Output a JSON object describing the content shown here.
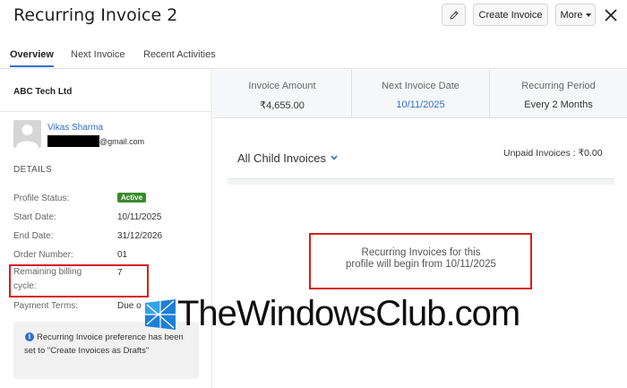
{
  "header": {
    "title": "Recurring Invoice 2",
    "create_label": "Create Invoice",
    "more_label": "More",
    "edit_icon": "pencil-icon",
    "close_icon": "close-icon"
  },
  "tabs": [
    {
      "label": "Overview",
      "active": true
    },
    {
      "label": "Next Invoice",
      "active": false
    },
    {
      "label": "Recent Activities",
      "active": false
    }
  ],
  "customer": {
    "company": "ABC Tech Ltd",
    "contact_name": "Vikas Sharma",
    "email_domain": "@gmail.com"
  },
  "details": {
    "heading": "DETAILS",
    "profile_status_label": "Profile Status:",
    "profile_status_value": "Active",
    "start_date_label": "Start Date:",
    "start_date_value": "10/11/2025",
    "end_date_label": "End Date:",
    "end_date_value": "31/12/2026",
    "order_number_label": "Order Number:",
    "order_number_value": "01",
    "remaining_label": "Remaining billing cycle:",
    "remaining_value": "7",
    "payment_terms_label": "Payment Terms:",
    "payment_terms_value": "Due o"
  },
  "note": {
    "text": "Recurring Invoice preference has been set to \"Create Invoices as Drafts\""
  },
  "summary": {
    "invoice_amount_label": "Invoice Amount",
    "invoice_amount_value": "₹4,655.00",
    "next_date_label": "Next Invoice Date",
    "next_date_value": "10/11/2025",
    "period_label": "Recurring Period",
    "period_value": "Every 2 Months"
  },
  "child_invoices": {
    "title": "All Child Invoices",
    "unpaid": "Unpaid Invoices : ₹0.00",
    "empty_line1": "Recurring Invoices for this",
    "empty_line2": "profile will begin from 10/11/2025"
  },
  "watermark": {
    "text": "TheWindowsClub.com"
  },
  "colors": {
    "accent": "#2d6fd1",
    "active_badge": "#3a8a2b",
    "highlight": "#d61f1f"
  }
}
